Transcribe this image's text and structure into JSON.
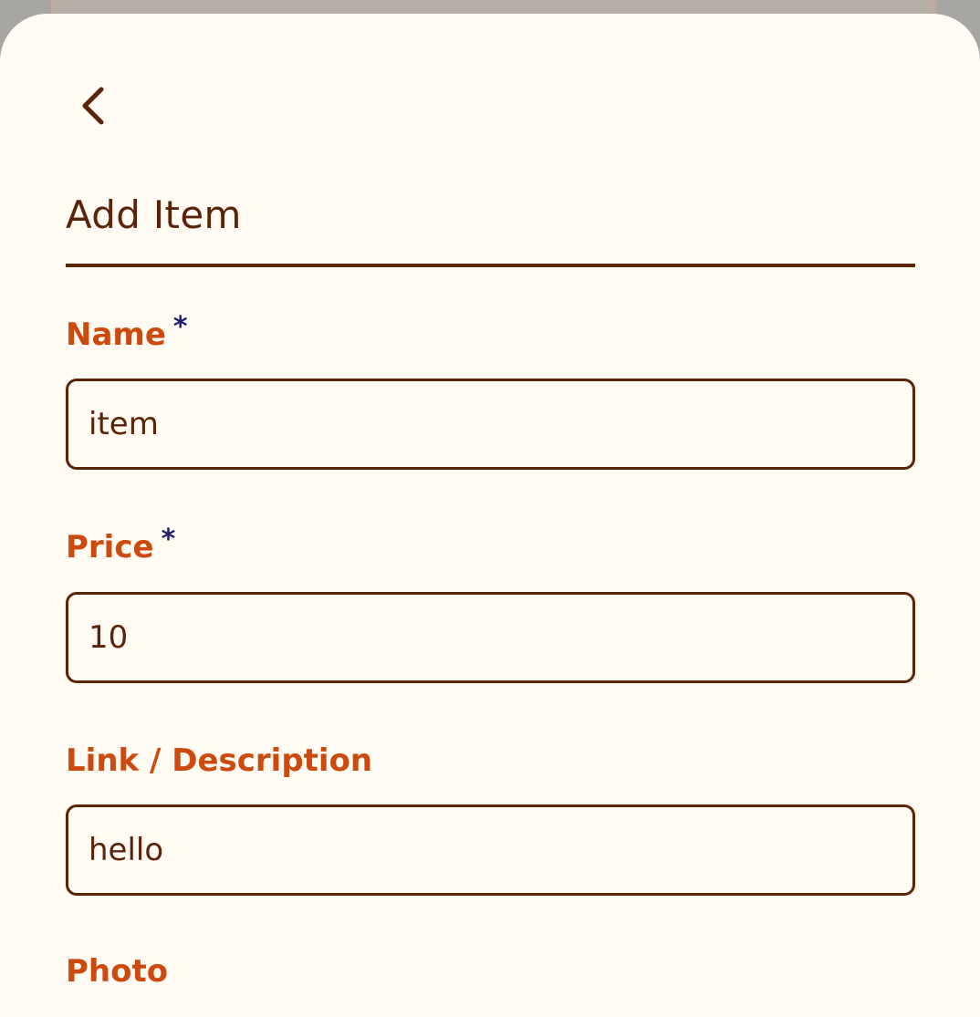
{
  "form": {
    "title": "Add Item",
    "required_marker": "*",
    "fields": [
      {
        "label": "Name",
        "required": true,
        "value": "item"
      },
      {
        "label": "Price",
        "required": true,
        "value": "10"
      },
      {
        "label": "Link / Description",
        "required": false,
        "value": "hello"
      },
      {
        "label": "Photo",
        "required": false
      }
    ]
  },
  "colors": {
    "sheet_background": "#fffaf2",
    "primary_text": "#5b2409",
    "label_accent": "#cc4a0e",
    "required_marker": "#1f1f6e"
  },
  "icons": {
    "back": "chevron-left-icon"
  }
}
